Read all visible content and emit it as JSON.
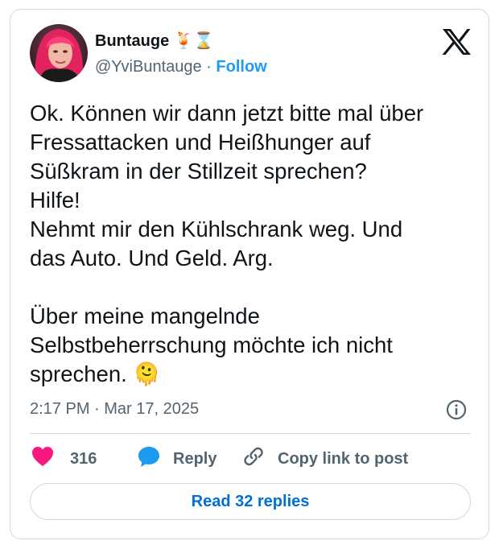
{
  "author": {
    "display_name": "Buntauge 🍹⌛",
    "handle": "@YviBuntauge",
    "separator": " · ",
    "follow_label": "Follow",
    "avatar": "profile-photo-avatar"
  },
  "tweet": {
    "text": "Ok. Können wir dann jetzt bitte mal über\nFressattacken und Heißhunger auf\nSüßkram in der Stillzeit sprechen?\nHilfe!\nNehmt mir den Kühlschrank weg. Und\ndas Auto. Und Geld. Arg.\n\nÜber meine mangelnde\nSelbstbeherrschung möchte ich nicht\nsprechen. 🫠",
    "timestamp": "2:17 PM · Mar 17, 2025"
  },
  "actions": {
    "like_count": "316",
    "reply_label": "Reply",
    "copy_label": "Copy link to post"
  },
  "read_replies_label": "Read 32 replies",
  "icons": {
    "brand": "x-logo-icon",
    "info": "info-icon",
    "like": "heart-icon",
    "reply": "speech-bubble-icon",
    "copy": "link-icon"
  },
  "colors": {
    "like": "#f91880",
    "reply_icon": "#1d9bf0",
    "link": "#1d9bf0",
    "read_replies": "#006fd6",
    "secondary_text": "#536471",
    "border": "#cfd9de"
  }
}
